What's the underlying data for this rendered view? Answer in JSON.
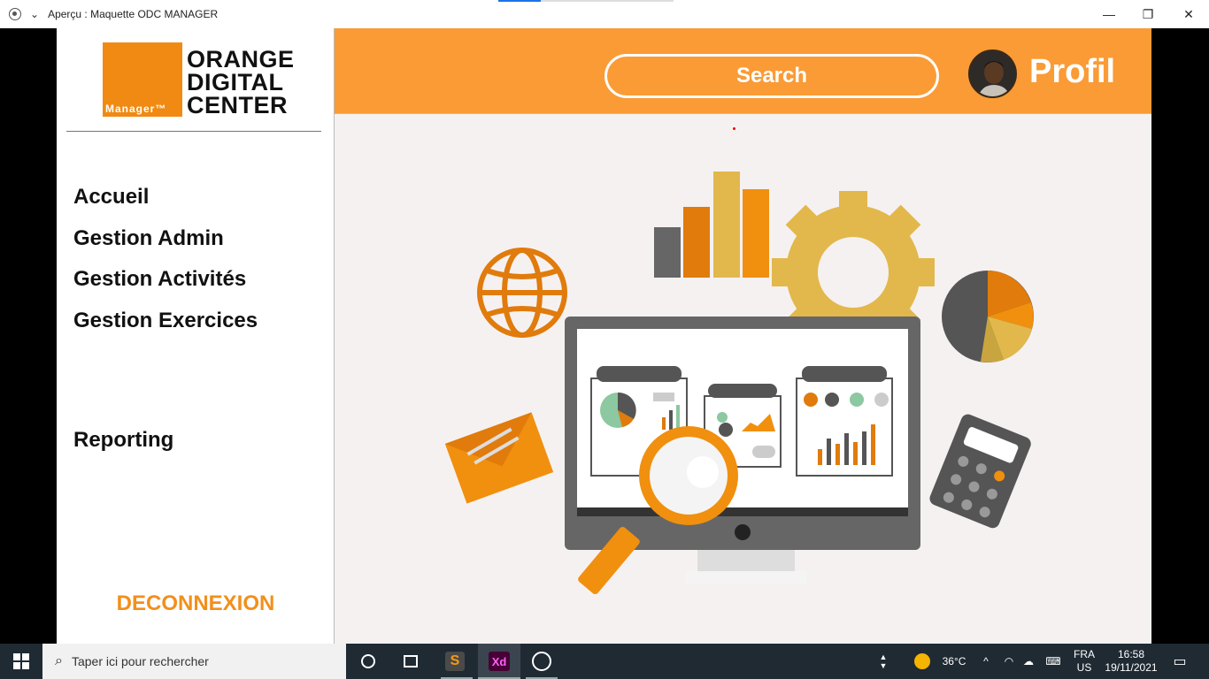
{
  "window": {
    "title": "Aperçu : Maquette ODC MANAGER",
    "minimize": "—",
    "restore": "❐",
    "close": "✕"
  },
  "logo": {
    "line1": "ORANGE",
    "line2": "DIGITAL",
    "line3": "CENTER",
    "badge": "Manager™"
  },
  "nav": {
    "items": [
      "Accueil",
      "Gestion Admin",
      "Gestion Activités",
      "Gestion Exercices",
      "Reporting"
    ],
    "logout": "DECONNEXION"
  },
  "header": {
    "search_label": "Search",
    "profile_label": "Profil"
  },
  "taskbar": {
    "search_placeholder": "Taper ici pour rechercher",
    "temperature": "36°C",
    "lang_top": "FRA",
    "lang_bottom": "US",
    "time": "16:58",
    "date": "19/11/2021"
  },
  "colors": {
    "accent": "#fa9b36",
    "logo_orange": "#f08a12",
    "logout_orange": "#f28f1c"
  }
}
